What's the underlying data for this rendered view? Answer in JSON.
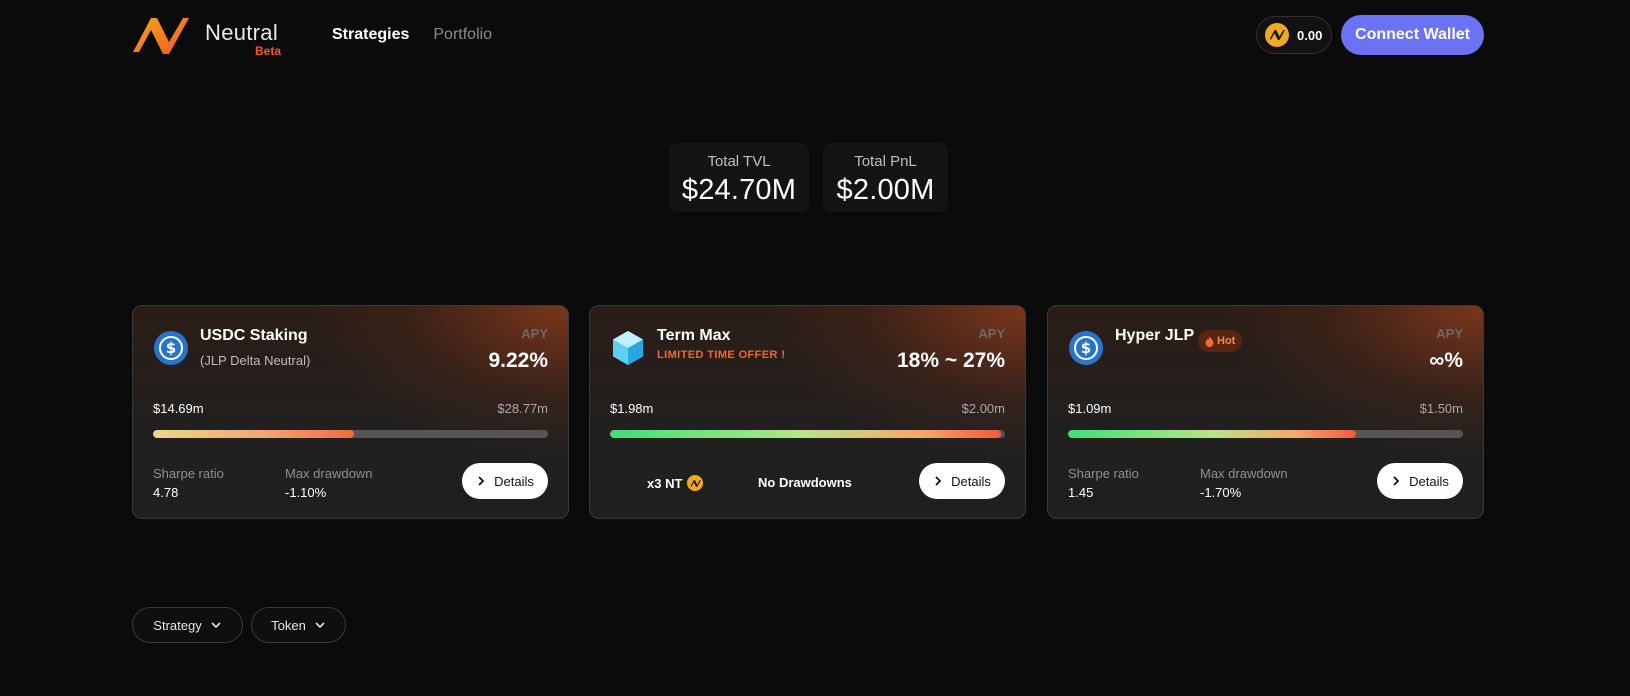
{
  "header": {
    "brand_name": "Neutral",
    "brand_badge": "Beta",
    "nav": [
      {
        "label": "Strategies",
        "active": true
      },
      {
        "label": "Portfolio",
        "active": false
      }
    ],
    "nt_balance": "0.00",
    "connect_label": "Connect Wallet",
    "accent_color": "#6b72f5"
  },
  "stats": {
    "tvl_label": "Total TVL",
    "tvl_value": "$24.70M",
    "pnl_label": "Total PnL",
    "pnl_value": "$2.00M"
  },
  "cards": [
    {
      "icon": "usdc-icon",
      "title": "USDC Staking",
      "subtitle": "(JLP Delta Neutral)",
      "apy_label": "APY",
      "apy": "9.22%",
      "low": "$14.69m",
      "high": "$28.77m",
      "progress": 0.51,
      "m1_label": "Sharpe ratio",
      "m1_value": "4.78",
      "m2_label": "Max drawdown",
      "m2_value": "-1.10%",
      "details_label": "Details"
    },
    {
      "icon": "term-max-icon",
      "title": "Term Max",
      "offer": "LIMITED TIME OFFER !",
      "apy_label": "APY",
      "apy": "18% ~ 27%",
      "low": "$1.98m",
      "high": "$2.00m",
      "progress": 0.99,
      "extra1": "x3 NT",
      "extra2": "No Drawdowns",
      "details_label": "Details"
    },
    {
      "icon": "usdc-icon",
      "title": "Hyper JLP",
      "badge": "Hot",
      "apy_label": "APY",
      "apy": "∞%",
      "low": "$1.09m",
      "high": "$1.50m",
      "progress": 0.73,
      "m1_label": "Sharpe ratio",
      "m1_value": "1.45",
      "m2_label": "Max drawdown",
      "m2_value": "-1.70%",
      "details_label": "Details"
    }
  ],
  "filters": {
    "strategy_label": "Strategy",
    "token_label": "Token"
  }
}
